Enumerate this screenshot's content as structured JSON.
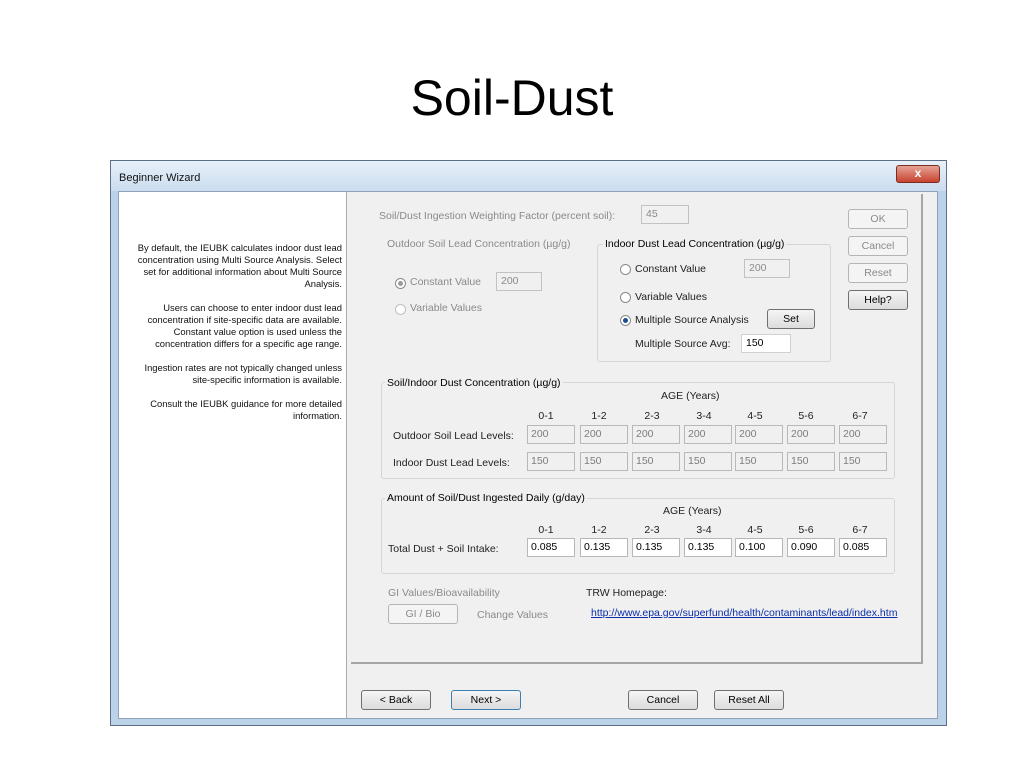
{
  "slide": {
    "title": "Soil-Dust"
  },
  "window": {
    "title": "Beginner Wizard",
    "close_glyph": "x"
  },
  "help_text": [
    "By default, the IEUBK calculates indoor dust lead concentration using Multi Source Analysis. Select set for additional information about Multi Source Analysis.",
    "Users can choose to enter indoor dust lead concentration if site-specific data are available. Constant value option is used unless the concentration differs for a specific age range.",
    "Ingestion rates are not typically changed unless site-specific information is available.",
    "Consult the IEUBK guidance for more detailed information."
  ],
  "weighting": {
    "label": "Soil/Dust Ingestion Weighting Factor (percent soil):",
    "value": "45"
  },
  "outdoor_soil": {
    "title": "Outdoor Soil Lead Concentration (µg/g)",
    "constant_label": "Constant Value",
    "constant_value": "200",
    "variable_label": "Variable Values",
    "selected": "constant"
  },
  "indoor_dust": {
    "title": "Indoor Dust Lead Concentration (µg/g)",
    "constant_label": "Constant Value",
    "constant_value": "200",
    "variable_label": "Variable Values",
    "multi_label": "Multiple Source Analysis",
    "set_label": "Set",
    "avg_label": "Multiple Source Avg:",
    "avg_value": "150",
    "selected": "multiple"
  },
  "side_buttons": {
    "ok": "OK",
    "cancel": "Cancel",
    "reset": "Reset",
    "help": "Help?"
  },
  "concentration": {
    "title": "Soil/Indoor Dust Concentration (µg/g)",
    "age_header": "AGE (Years)",
    "ages": [
      "0-1",
      "1-2",
      "2-3",
      "3-4",
      "4-5",
      "5-6",
      "6-7"
    ],
    "rows": [
      {
        "label": "Outdoor Soil Lead Levels:",
        "values": [
          "200",
          "200",
          "200",
          "200",
          "200",
          "200",
          "200"
        ]
      },
      {
        "label": "Indoor Dust Lead Levels:",
        "values": [
          "150",
          "150",
          "150",
          "150",
          "150",
          "150",
          "150"
        ]
      }
    ]
  },
  "ingested": {
    "title": "Amount of Soil/Dust Ingested Daily (g/day)",
    "age_header": "AGE (Years)",
    "ages": [
      "0-1",
      "1-2",
      "2-3",
      "3-4",
      "4-5",
      "5-6",
      "6-7"
    ],
    "row_label": "Total Dust + Soil Intake:",
    "values": [
      "0.085",
      "0.135",
      "0.135",
      "0.135",
      "0.100",
      "0.090",
      "0.085"
    ]
  },
  "gi": {
    "title": "GI Values/Bioavailability",
    "button": "GI / Bio",
    "change": "Change Values"
  },
  "trw": {
    "label": "TRW Homepage:",
    "url": "http://www.epa.gov/superfund/health/contaminants/lead/index.htm"
  },
  "footer": {
    "back": "< Back",
    "next": "Next >",
    "cancel": "Cancel",
    "reset_all": "Reset All"
  }
}
